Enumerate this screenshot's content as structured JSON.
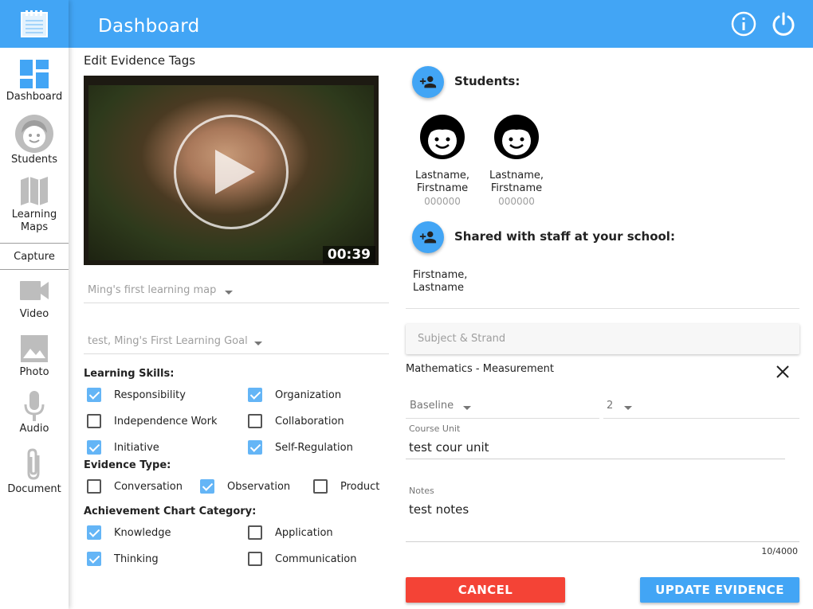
{
  "header": {
    "title": "Dashboard"
  },
  "sidebar": {
    "items": [
      {
        "label": "Dashboard",
        "icon": "dashboard-icon"
      },
      {
        "label": "Students",
        "icon": "student-face-icon"
      },
      {
        "label": "Learning\nMaps",
        "icon": "map-icon"
      }
    ],
    "capture_label": "Capture",
    "capture_items": [
      {
        "label": "Video",
        "icon": "video-camera-icon"
      },
      {
        "label": "Photo",
        "icon": "photo-icon"
      },
      {
        "label": "Audio",
        "icon": "microphone-icon"
      },
      {
        "label": "Document",
        "icon": "paperclip-icon"
      }
    ]
  },
  "edit": {
    "title": "Edit Evidence Tags",
    "video_duration": "00:39",
    "learning_map": "Ming's first learning map",
    "learning_goal": "test, Ming's First Learning Goal"
  },
  "learning_skills": {
    "label": "Learning Skills:",
    "items": [
      {
        "label": "Responsibility",
        "checked": true
      },
      {
        "label": "Organization",
        "checked": true
      },
      {
        "label": "Independence Work",
        "checked": false
      },
      {
        "label": "Collaboration",
        "checked": false
      },
      {
        "label": "Initiative",
        "checked": true
      },
      {
        "label": "Self-Regulation",
        "checked": true
      }
    ]
  },
  "evidence_type": {
    "label": "Evidence Type:",
    "items": [
      {
        "label": "Conversation",
        "checked": false
      },
      {
        "label": "Observation",
        "checked": true
      },
      {
        "label": "Product",
        "checked": false
      }
    ]
  },
  "achievement": {
    "label": "Achievement Chart Category:",
    "items": [
      {
        "label": "Knowledge",
        "checked": true
      },
      {
        "label": "Application",
        "checked": false
      },
      {
        "label": "Thinking",
        "checked": true
      },
      {
        "label": "Communication",
        "checked": false
      }
    ]
  },
  "students": {
    "label": "Students:",
    "list": [
      {
        "name": "Lastname,\nFirstname",
        "id": "000000"
      },
      {
        "name": "Lastname,\nFirstname",
        "id": "000000"
      }
    ]
  },
  "shared": {
    "label": "Shared with staff at your school:",
    "staff": "Firstname,\nLastname"
  },
  "subject": {
    "placeholder": "Subject & Strand",
    "selected": "Mathematics - Measurement",
    "level": "Baseline",
    "level_value": "2"
  },
  "course_unit": {
    "label": "Course Unit",
    "value": "test cour unit"
  },
  "notes": {
    "label": "Notes",
    "value": "test notes",
    "counter": "10/4000"
  },
  "actions": {
    "cancel": "CANCEL",
    "update": "UPDATE EVIDENCE"
  },
  "colors": {
    "primary": "#42a5f5",
    "danger": "#f44336",
    "checked": "#64b5f6"
  }
}
